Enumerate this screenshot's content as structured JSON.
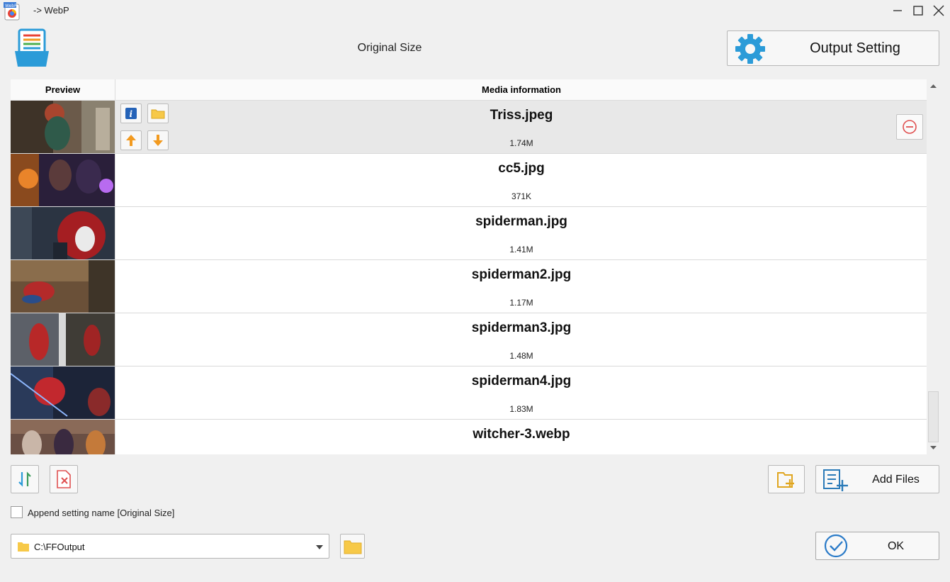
{
  "window": {
    "title": "-> WebP"
  },
  "header": {
    "center_label": "Original Size",
    "output_setting_label": "Output Setting"
  },
  "table": {
    "col_preview": "Preview",
    "col_info": "Media information",
    "rows": [
      {
        "name": "Triss.jpeg",
        "size": "1.74M"
      },
      {
        "name": "cc5.jpg",
        "size": "371K"
      },
      {
        "name": "spiderman.jpg",
        "size": "1.41M"
      },
      {
        "name": "spiderman2.jpg",
        "size": "1.17M"
      },
      {
        "name": "spiderman3.jpg",
        "size": "1.48M"
      },
      {
        "name": "spiderman4.jpg",
        "size": "1.83M"
      },
      {
        "name": "witcher-3.webp",
        "size": ""
      }
    ]
  },
  "bottom": {
    "add_files_label": "Add Files",
    "append_label": "Append setting name [Original Size]",
    "append_checked": false,
    "output_path": "C:\\FFOutput",
    "ok_label": "OK"
  },
  "colors": {
    "accent_blue": "#2b9bd8",
    "orange": "#f29a1f",
    "folder_yellow": "#f7c948",
    "remove_red": "#e05050"
  }
}
